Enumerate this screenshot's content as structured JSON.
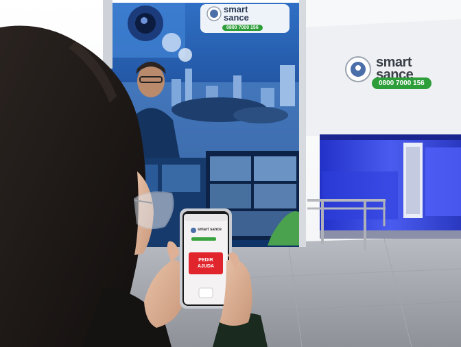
{
  "wall_sign": {
    "brand_line1": "smart",
    "brand_line2": "sance",
    "pill": "0800 7000 156"
  },
  "banner_sign": {
    "brand_line1": "smart",
    "brand_line2": "sance",
    "pill": "0800 7000 156"
  },
  "phone_app": {
    "brand": "smart sance",
    "help_button": "PEDIR\nAJUDA"
  },
  "colors": {
    "help_red": "#e0262c",
    "brand_green": "#2e9e3a",
    "room_blue": "#3a4ee0"
  }
}
